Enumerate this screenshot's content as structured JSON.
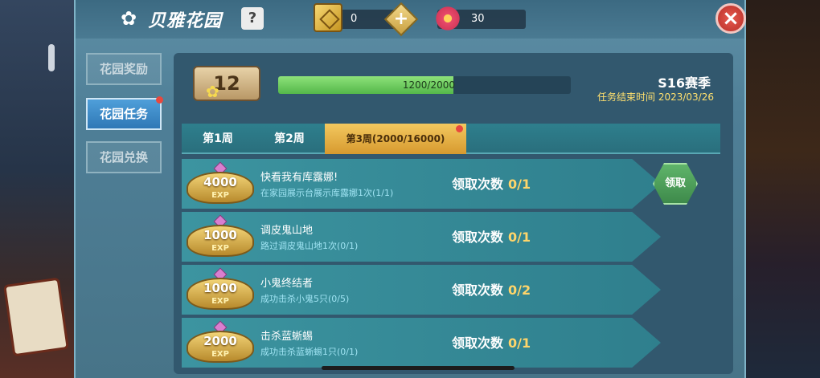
{
  "header": {
    "title": "贝雅花园",
    "help_label": "?",
    "currency_1": "0",
    "currency_2": "30",
    "plus_label": "+",
    "close_label": "×"
  },
  "sidebar": {
    "items": [
      {
        "label": "花园奖励",
        "active": false
      },
      {
        "label": "花园任务",
        "active": true
      },
      {
        "label": "花园兑换",
        "active": false
      }
    ]
  },
  "level": {
    "value": "12",
    "progress_text": "1200/2000",
    "progress": 0.6
  },
  "season": {
    "label": "S16赛季",
    "end_text": "任务结束时间 2023/03/26"
  },
  "weeks": [
    {
      "label": "第1周",
      "active": false
    },
    {
      "label": "第2周",
      "active": false
    },
    {
      "label": "第3周(2000/16000)",
      "active": true
    }
  ],
  "tasks": [
    {
      "exp": "4000",
      "exp_unit": "EXP",
      "title": "快看我有库露娜!",
      "desc": "在家园展示台展示库露娜1次(1/1)",
      "count_label": "领取次数",
      "count": "0/1",
      "claim_label": "领取"
    },
    {
      "exp": "1000",
      "exp_unit": "EXP",
      "title": "调皮鬼山地",
      "desc": "路过调皮鬼山地1次(0/1)",
      "count_label": "领取次数",
      "count": "0/1"
    },
    {
      "exp": "1000",
      "exp_unit": "EXP",
      "title": "小鬼终结者",
      "desc": "成功击杀小鬼5只(0/5)",
      "count_label": "领取次数",
      "count": "0/2"
    },
    {
      "exp": "2000",
      "exp_unit": "EXP",
      "title": "击杀蓝蜥蜴",
      "desc": "成功击杀蓝蜥蜴1只(0/1)",
      "count_label": "领取次数",
      "count": "0/1"
    }
  ],
  "colors": {
    "panel": "#4f7f97",
    "active_tab": "#2f78b6",
    "week_active": "#f3c85f",
    "progress": "#8ee27a",
    "claim": "#3e8a4b"
  }
}
